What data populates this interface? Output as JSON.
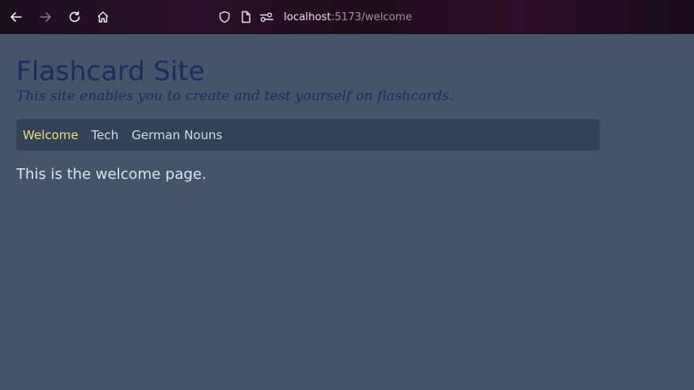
{
  "browser": {
    "url_host": "localhost",
    "url_path": ":5173/welcome"
  },
  "page": {
    "title": "Flashcard Site",
    "subtitle": "This site enables you to create and test yourself on flashcards.",
    "nav": [
      {
        "label": "Welcome",
        "active": true
      },
      {
        "label": "Tech",
        "active": false
      },
      {
        "label": "German Nouns",
        "active": false
      }
    ],
    "body_text": "This is the welcome page."
  },
  "colors": {
    "background": "#455468",
    "title": "#1f2a60",
    "navbar": "#334256",
    "nav_active": "#e3e07a",
    "nav_inactive": "#d5dbe3",
    "browser_bar": "#2a1028"
  },
  "icons": {
    "back": "back-arrow-icon",
    "forward": "forward-arrow-icon",
    "reload": "reload-icon",
    "home": "home-icon",
    "shield": "shield-icon",
    "page": "page-icon",
    "permissions": "permissions-icon"
  }
}
